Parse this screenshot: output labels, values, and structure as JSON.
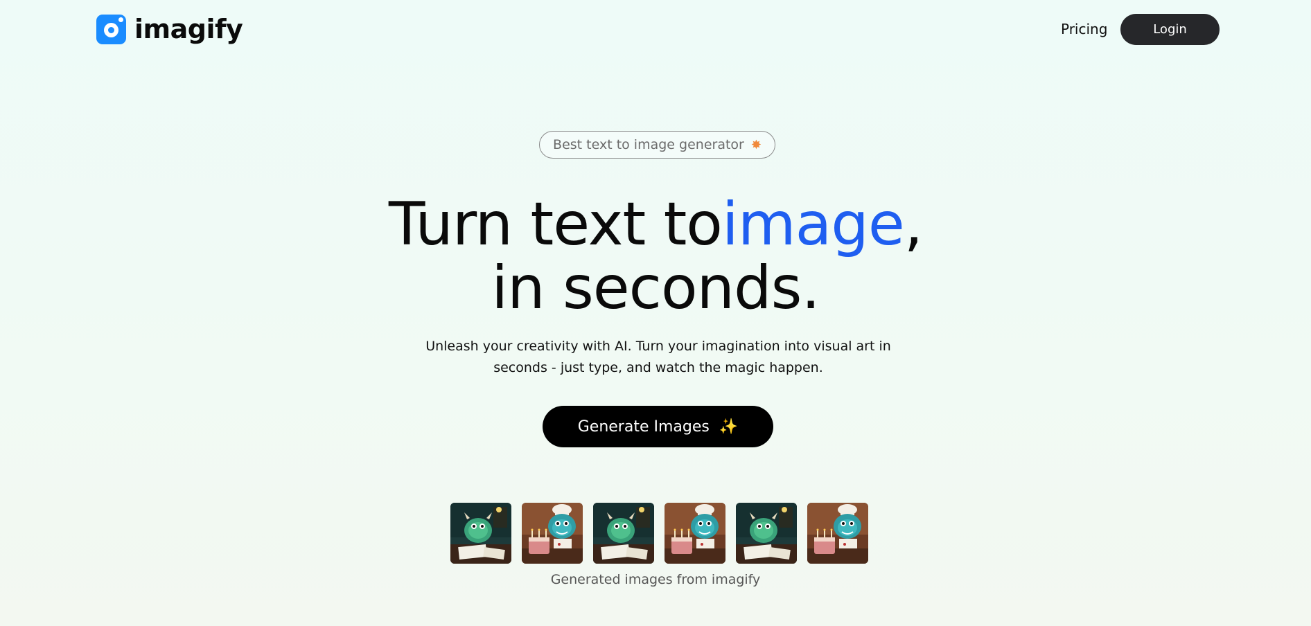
{
  "brand": {
    "name": "imagify",
    "accent_color": "#1a8cff"
  },
  "nav": {
    "pricing_label": "Pricing",
    "login_label": "Login"
  },
  "hero": {
    "badge_text": "Best text to image generator",
    "badge_icon": "star-icon",
    "headline_part1": "Turn text to",
    "headline_accent": "image",
    "headline_part2": ",",
    "headline_line2": "in seconds.",
    "accent_color": "#1f5ef0",
    "subtitle": "Unleash your creativity with AI. Turn your imagination into visual art in seconds - just type, and watch the magic happen.",
    "cta_label": "Generate Images",
    "cta_icon": "sparkle-icon"
  },
  "gallery": {
    "thumbnails": [
      {
        "scene": "monster-at-desk"
      },
      {
        "scene": "monster-chef-cake"
      },
      {
        "scene": "monster-at-desk"
      },
      {
        "scene": "monster-chef-cake"
      },
      {
        "scene": "monster-at-desk"
      },
      {
        "scene": "monster-chef-cake"
      }
    ],
    "caption": "Generated images from imagify"
  }
}
